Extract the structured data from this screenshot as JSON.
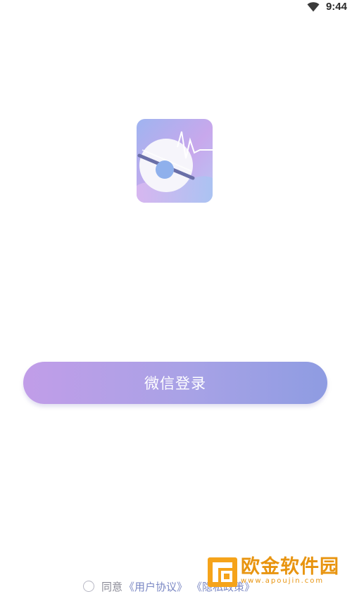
{
  "status_bar": {
    "time": "9:44",
    "wifi_icon": "wifi-icon"
  },
  "app": {
    "logo_icon": "app-logo-icon"
  },
  "login": {
    "button_label": "微信登录",
    "button_colors": [
      "#c19de8",
      "#8e9ce2"
    ]
  },
  "agreement": {
    "prefix": "同意",
    "user_agreement": "《用户协议》",
    "privacy_policy": "《隐私政策》",
    "checked": false
  },
  "watermark": {
    "title": "欧金软件园",
    "url": "www.apoujin.com",
    "color": "#e8940f"
  }
}
